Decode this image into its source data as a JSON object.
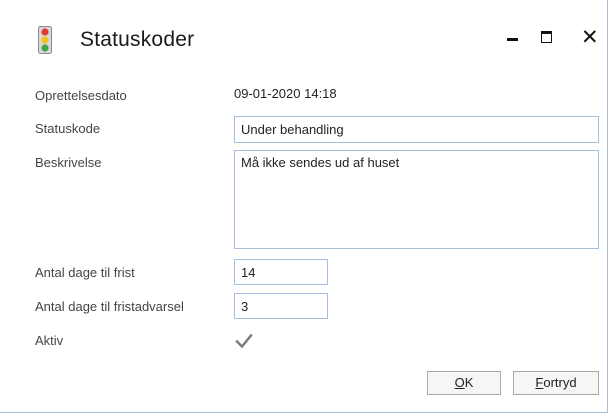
{
  "window": {
    "title": "Statuskoder",
    "icon": "traffic-light-icon",
    "controls": {
      "minimize": "minimize-icon",
      "maximize": "maximize-icon",
      "close": "close-icon"
    }
  },
  "form": {
    "created_label": "Oprettelsesdato",
    "created_value": "09-01-2020 14:18",
    "status_code_label": "Statuskode",
    "status_code_value": "Under behandling",
    "description_label": "Beskrivelse",
    "description_value": "Må ikke sendes ud af huset",
    "deadline_days_label": "Antal dage til frist",
    "deadline_days_value": "14",
    "warning_days_label": "Antal dage til fristadvarsel",
    "warning_days_value": "3",
    "active_label": "Aktiv",
    "active_checked": true
  },
  "buttons": {
    "ok_label": "OK",
    "cancel_label": "Fortryd"
  },
  "colors": {
    "field_border": "#a4c0de",
    "light_red": "#e23b2e",
    "light_yellow": "#f2c21b",
    "light_green": "#44a544"
  }
}
